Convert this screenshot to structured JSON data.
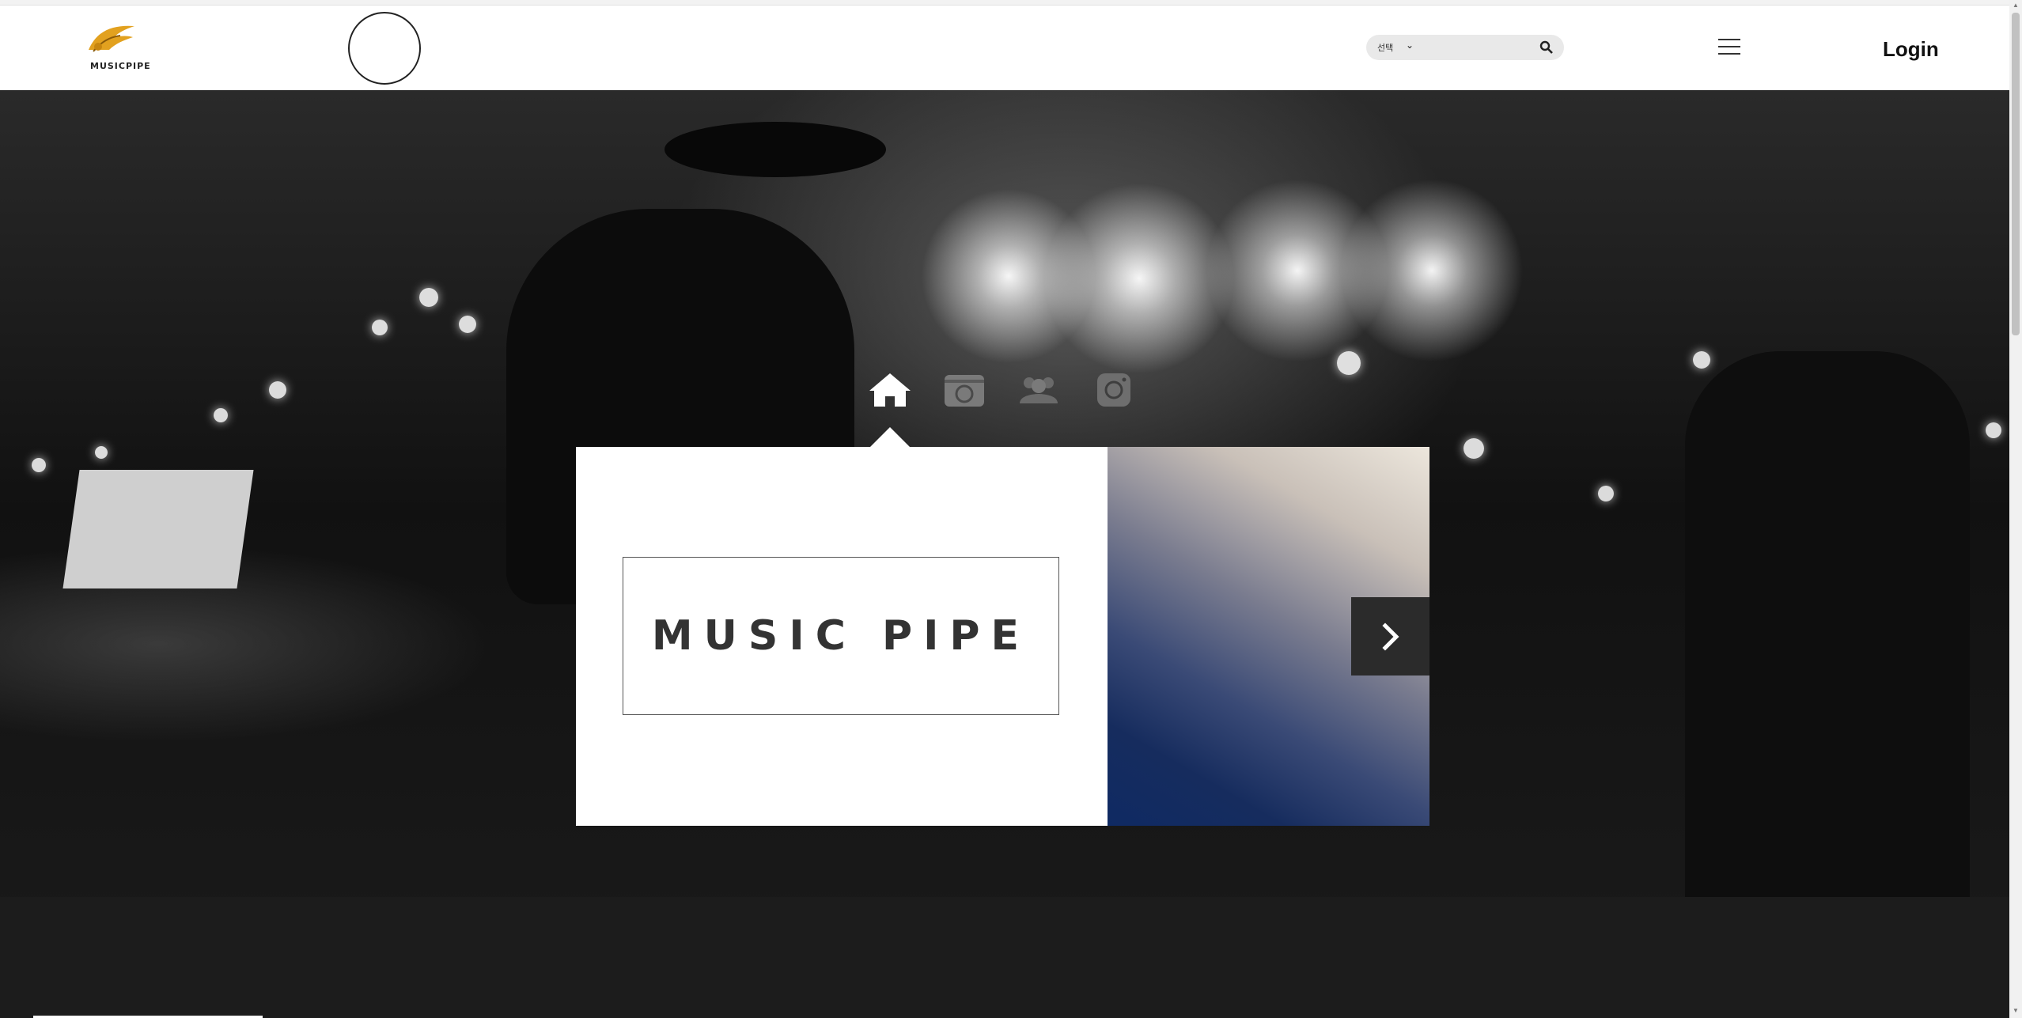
{
  "header": {
    "logo_text": "MUSICPIPE",
    "search": {
      "select_value": "선택",
      "icon": "search-icon"
    },
    "menu_icon": "hamburger-icon",
    "login_label": "Login"
  },
  "tabs": [
    {
      "name": "home",
      "icon": "home-icon",
      "active": true
    },
    {
      "name": "camera",
      "icon": "camera-icon",
      "active": false
    },
    {
      "name": "community",
      "icon": "users-icon",
      "active": false
    },
    {
      "name": "instagram",
      "icon": "instagram-icon",
      "active": false
    }
  ],
  "slide": {
    "title": "MUSIC PIPE",
    "next_icon": "chevron-right-icon"
  },
  "colors": {
    "header_bg": "#ffffff",
    "panel_bg": "#ffffff",
    "next_button_bg": "#2b2b2b",
    "gradient_dark": "#0f2a63",
    "gradient_light": "#ece6dc"
  }
}
